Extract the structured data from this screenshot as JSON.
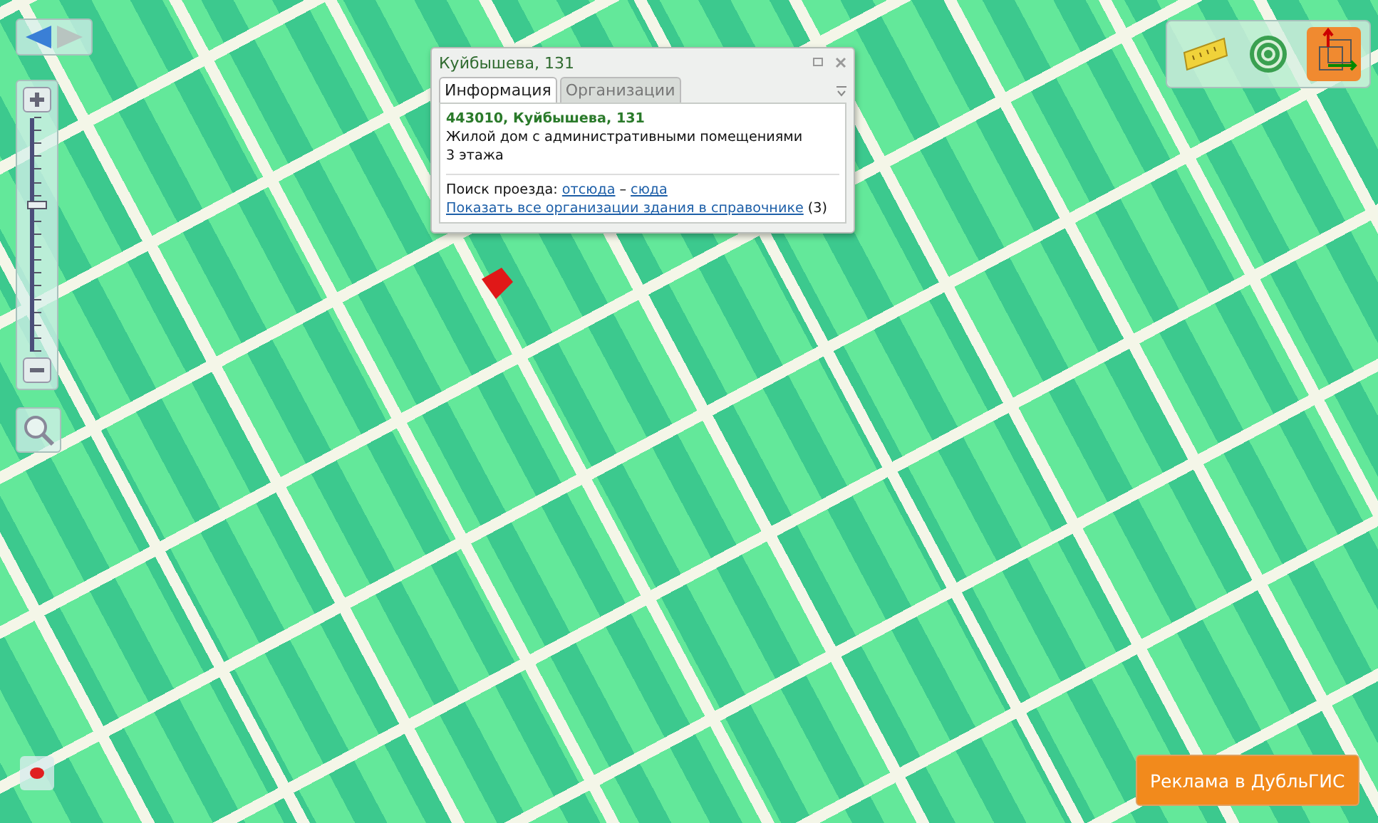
{
  "popup": {
    "title": "Куйбышева, 131",
    "tabs": [
      {
        "label": "Информация",
        "selected": true
      },
      {
        "label": "Организации",
        "selected": false
      }
    ],
    "address": "443010, Куйбышева, 131",
    "description": "Жилой дом с административными помещениями",
    "floors": "3 этажа",
    "route_label": "Поиск проезда:",
    "route_from": "отсюда",
    "route_separator": "–",
    "route_to": "сюда",
    "all_orgs_link": "Показать все организации здания в справочнике",
    "all_orgs_count": "(3)"
  },
  "zoom": {
    "level": 0.63
  },
  "ad_button": "Реклама в ДубльГИС"
}
